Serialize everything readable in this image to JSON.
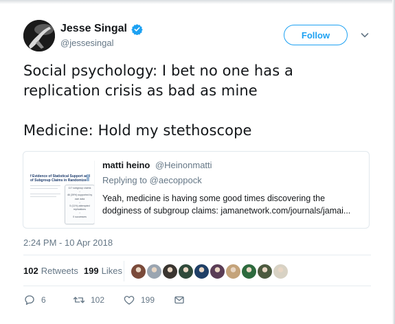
{
  "author": {
    "display_name": "Jesse Singal",
    "handle": "@jessesingal",
    "verified": true,
    "avatar_icon": "avatar-image"
  },
  "header": {
    "follow_label": "Follow",
    "more_icon": "chevron-down-icon"
  },
  "tweet": {
    "line1": "Social psychology: I bet no one has a",
    "line2": "replication crisis as bad as mine",
    "line3": "Medicine: Hold my stethoscope"
  },
  "quoted": {
    "name": "matti heino",
    "handle": "@Heinonmatti",
    "replying_prefix": "Replying to ",
    "replying_to": "@aecoppock",
    "body_line1": "Yeah, medicine is having some good times discovering the",
    "body_line2": "dodginess of subgroup claims: jamanetwork.com/journals/jamai...",
    "thumb": {
      "title_line1": "f Evidence of Statistical Support and",
      "title_line2": "of Subgroup Claims in Randomized",
      "flow_lines": [
        "117 subgroup claims",
        "↓",
        "46 (39%) supported by",
        "own data",
        "↓",
        "5 (11%) attempted",
        "replications",
        "↓",
        "0 successes"
      ]
    }
  },
  "timestamp": "2:24 PM - 10 Apr 2018",
  "stats": {
    "retweets_count": "102",
    "retweets_label": "Retweets",
    "likes_count": "199",
    "likes_label": "Likes"
  },
  "likers": [
    {
      "name": "liker-1",
      "color": "#7a4a3a"
    },
    {
      "name": "liker-2",
      "color": "#9aa5b1"
    },
    {
      "name": "liker-3",
      "color": "#3a3530"
    },
    {
      "name": "liker-4",
      "color": "#2f4a3b"
    },
    {
      "name": "liker-5",
      "color": "#1f3f66"
    },
    {
      "name": "liker-6",
      "color": "#5a3d56"
    },
    {
      "name": "liker-7",
      "color": "#c4a37a"
    },
    {
      "name": "liker-8",
      "color": "#2d6a3e"
    },
    {
      "name": "liker-9",
      "color": "#4c5a3f"
    },
    {
      "name": "liker-10",
      "color": "#d8d2c4"
    }
  ],
  "actions": {
    "reply_count": "6",
    "retweet_count": "102",
    "like_count": "199"
  },
  "colors": {
    "accent": "#1da1f2",
    "muted": "#657786",
    "text": "#14171a",
    "border": "#e1e8ed"
  }
}
